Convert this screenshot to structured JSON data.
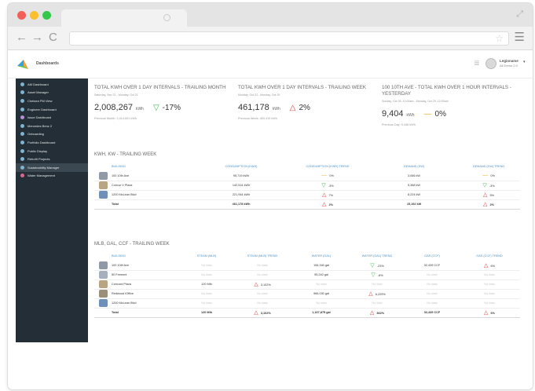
{
  "browser": {
    "nav": {
      "back": "←",
      "forward": "→",
      "reload": "C"
    },
    "star": "☆",
    "menu": "☰",
    "expand": "⤢"
  },
  "app": {
    "title": "Dashboards",
    "grid_glyph": "⁞⁞⁞",
    "user": {
      "name": "Legioname",
      "sub": "All Demo 2.0",
      "caret": "▾"
    }
  },
  "sidebar": {
    "items": [
      {
        "label": "AM Dashboard",
        "color": "#7fb3cf"
      },
      {
        "label": "Asset Manager",
        "color": "#7fb3cf"
      },
      {
        "label": "Chelsea PM View",
        "color": "#7fb3cf"
      },
      {
        "label": "Engineer Dashboard",
        "color": "#7fb3cf"
      },
      {
        "label": "Issue Dashboard",
        "color": "#b58fd4"
      },
      {
        "label": "Mercedes Benz 2",
        "color": "#7fb3cf"
      },
      {
        "label": "Onboarding",
        "color": "#7fb3cf"
      },
      {
        "label": "Portfolio Dashboard",
        "color": "#7fb3cf"
      },
      {
        "label": "Public Display",
        "color": "#7fb3cf"
      },
      {
        "label": "Retrofit Projects",
        "color": "#7fb3cf"
      },
      {
        "label": "Sustainability Manager",
        "color": "#7fb3cf"
      },
      {
        "label": "Water Management",
        "color": "#d46a8f"
      }
    ],
    "active_index": 10
  },
  "kpis": [
    {
      "title": "TOTAL KWH OVER 1 DAY INTERVALS - TRAILING MONTH",
      "dates": "Saturday, Sep 21 - Monday, Oct 21",
      "value": "2,008,267",
      "unit": "kWh",
      "trend_glyph": "▽",
      "trend": "down",
      "pct": "-17%",
      "prev": "Previous Month: 2,414,501 kWh"
    },
    {
      "title": "TOTAL KWH OVER 1 DAY INTERVALS - TRAILING WEEK",
      "dates": "Monday, Oct 22 - Monday, Oct 29",
      "value": "461,178",
      "unit": "kWh",
      "trend_glyph": "△",
      "trend": "up",
      "pct": "2%",
      "prev": "Previous Week: 453,419 kWh"
    },
    {
      "title": "100 10TH AVE - TOTAL KWH OVER 1 HOUR INTERVALS - YESTERDAY",
      "dates": "Sunday, Oct 28, 12:00am - Monday, Oct 29, 12:00am",
      "value": "9,404",
      "unit": "kWh",
      "trend_glyph": "—",
      "trend": "flat",
      "pct": "0%",
      "prev": "Previous Day: 9,446 kWh"
    }
  ],
  "kwh_table": {
    "title": "KWH, KW - TRAILING WEEK",
    "headers": [
      "BUILDING",
      "CONSUMPTION (KWH)",
      "CONSUMPTION (KWH) TREND",
      "DEMAND (KW)",
      "DEMAND (KW) TREND"
    ],
    "rows": [
      {
        "img": "#8f9aa6",
        "building": "100 10th Ave",
        "consumption": "95,719 kWh",
        "ct_glyph": "—",
        "ct": "flat",
        "ct_pct": "0%",
        "demand": "3,066 kW",
        "dt_glyph": "—",
        "dt": "flat",
        "dt_pct": "0%"
      },
      {
        "img": "#b9a582",
        "building": "Concur V Plaza",
        "consumption": "142,514 kWh",
        "ct_glyph": "▽",
        "ct": "down",
        "ct_pct": "-3%",
        "demand": "5,368 kW",
        "dt_glyph": "▽",
        "dt": "down",
        "dt_pct": "-3%"
      },
      {
        "img": "#6d8fb8",
        "building": "1200 McLean Blvd",
        "consumption": "221,944 kWh",
        "ct_glyph": "△",
        "ct": "up",
        "ct_pct": "7%",
        "demand": "8,224 kW",
        "dt_glyph": "△",
        "dt": "up",
        "dt_pct": "5%"
      }
    ],
    "total": {
      "label": "Total",
      "consumption": "461,178 kWh",
      "ct_glyph": "△",
      "ct": "up",
      "ct_pct": "2%",
      "demand": "15,192 kW",
      "dt_glyph": "△",
      "dt": "up",
      "dt_pct": "2%"
    }
  },
  "mlb_table": {
    "title": "MLB, GAL, CCF - TRAILING WEEK",
    "headers": [
      "BUILDING",
      "STEAM (MLB)",
      "STEAM (MLB) TREND",
      "WATER (GAL)",
      "WATER (GAL) TREND",
      "GAS (CCF)",
      "GAS (CCF) TREND"
    ],
    "no_data": "No data",
    "rows": [
      {
        "img": "#8f9aa6",
        "building": "100 10th Ave",
        "steam": "",
        "st_glyph": "",
        "st": "",
        "st_pct": "",
        "water": "106,340 gal",
        "wt_glyph": "▽",
        "wt": "down",
        "wt_pct": "-23%",
        "gas": "32,439 CCF",
        "gt_glyph": "△",
        "gt": "up",
        "gt_pct": "6%"
      },
      {
        "img": "#a7aebc",
        "building": "50 Fremont",
        "steam": "",
        "st_glyph": "",
        "st": "",
        "st_pct": "",
        "water": "95,240 gal",
        "wt_glyph": "▽",
        "wt": "down",
        "wt_pct": "-8%",
        "gas": "",
        "gt_glyph": "",
        "gt": "",
        "gt_pct": ""
      },
      {
        "img": "#b9a582",
        "building": "Concord Plaza",
        "steam": "120 Mlb",
        "st_glyph": "△",
        "st": "up",
        "st_pct": "3,102%",
        "water": "",
        "wt_glyph": "",
        "wt": "",
        "wt_pct": "",
        "gas": "",
        "gt_glyph": "",
        "gt": "",
        "gt_pct": ""
      },
      {
        "img": "#9c8f7a",
        "building": "Redwood IOffice",
        "steam": "",
        "st_glyph": "",
        "st": "",
        "st_pct": "",
        "water": "966,030 gal",
        "wt_glyph": "△",
        "wt": "up",
        "wt_pct": "6,229%",
        "gas": "",
        "gt_glyph": "",
        "gt": "",
        "gt_pct": ""
      },
      {
        "img": "#6d8fb8",
        "building": "1200 McLean Blvd",
        "steam": "",
        "st_glyph": "",
        "st": "",
        "st_pct": "",
        "water": "",
        "wt_glyph": "",
        "wt": "",
        "wt_pct": "",
        "gas": "",
        "gt_glyph": "",
        "gt": "",
        "gt_pct": ""
      }
    ],
    "total": {
      "label": "Total",
      "steam": "120 Mlb",
      "st_glyph": "△",
      "st": "up",
      "st_pct": "3,102%",
      "water": "1,167,875 gal",
      "wt_glyph": "△",
      "wt": "up",
      "wt_pct": "362%",
      "gas": "32,439 CCF",
      "gt_glyph": "△",
      "gt": "up",
      "gt_pct": "6%"
    }
  }
}
